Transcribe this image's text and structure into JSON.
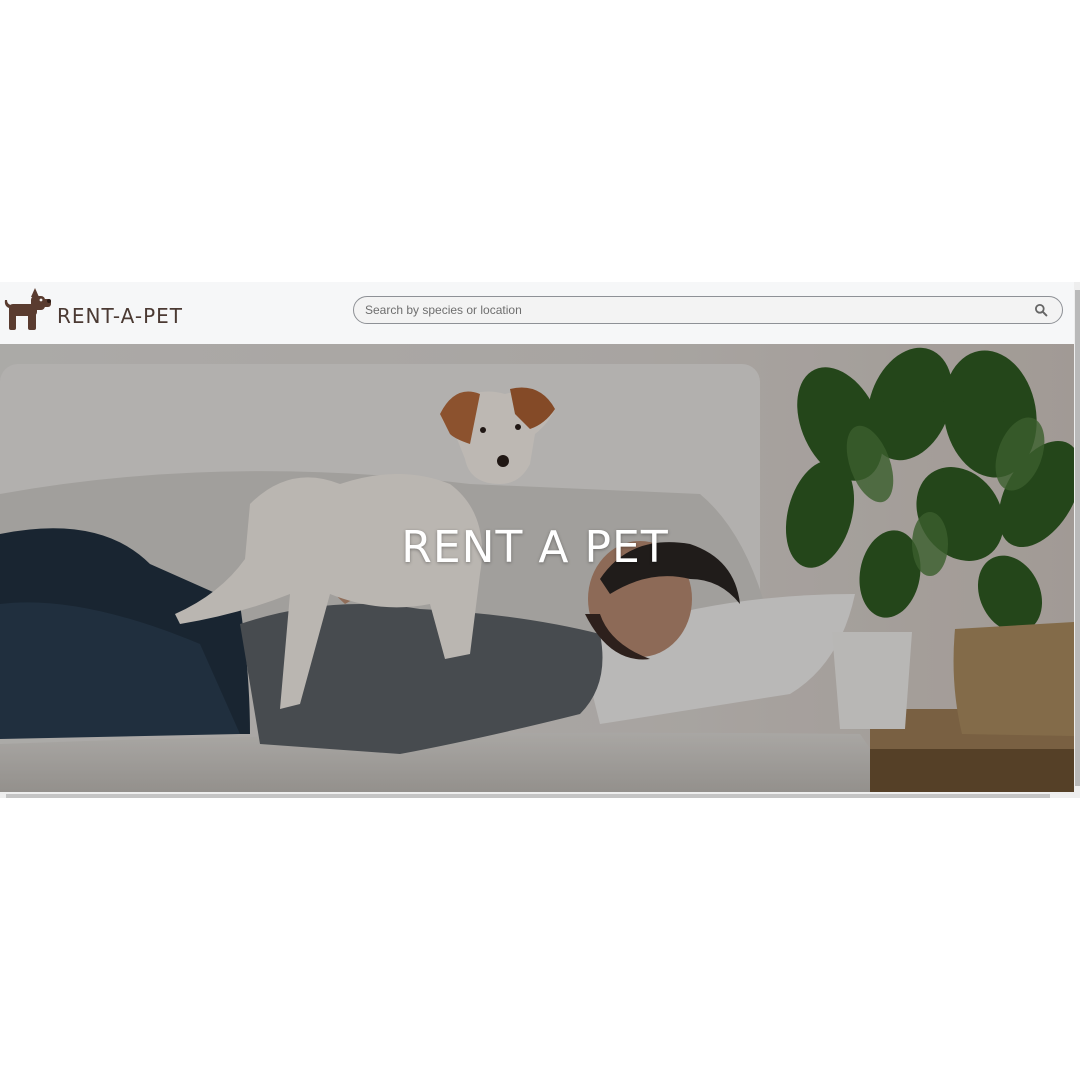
{
  "brand": {
    "name": "RENT-A-PET",
    "logo_icon": "dog-icon",
    "logo_color": "#5a3c30"
  },
  "search": {
    "placeholder": "Search by species or location",
    "value": "",
    "icon": "search-icon"
  },
  "hero": {
    "title": "RENT A PET",
    "image": "man-lying-on-sofa-with-puppy"
  },
  "colors": {
    "navbar_bg": "#f6f7f8",
    "brand_text": "#4b3a33",
    "hero_text": "#ffffff"
  }
}
